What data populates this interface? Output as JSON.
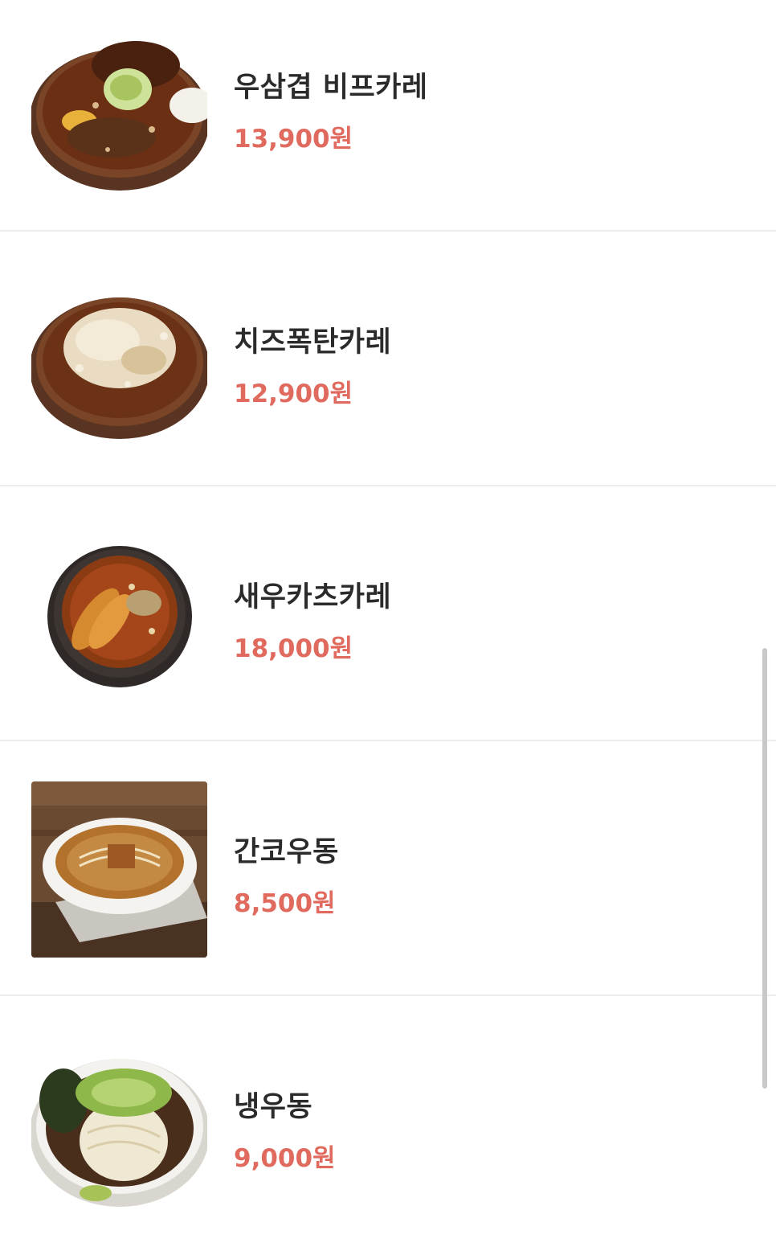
{
  "menu": {
    "items": [
      {
        "name": "우삼겹 비프카레",
        "price": "13,900원",
        "image_icon": "beef-curry-dish-icon"
      },
      {
        "name": "치즈폭탄카레",
        "price": "12,900원",
        "image_icon": "cheese-curry-dish-icon"
      },
      {
        "name": "새우카츠카레",
        "price": "18,000원",
        "image_icon": "shrimp-katsu-curry-dish-icon"
      },
      {
        "name": "간코우동",
        "price": "8,500원",
        "image_icon": "udon-bowl-icon"
      },
      {
        "name": "냉우동",
        "price": "9,000원",
        "image_icon": "cold-udon-bowl-icon"
      }
    ]
  },
  "colors": {
    "price": "#e06a5e",
    "name": "#2b2b2b",
    "divider": "#ececec",
    "background": "#ffffff"
  }
}
